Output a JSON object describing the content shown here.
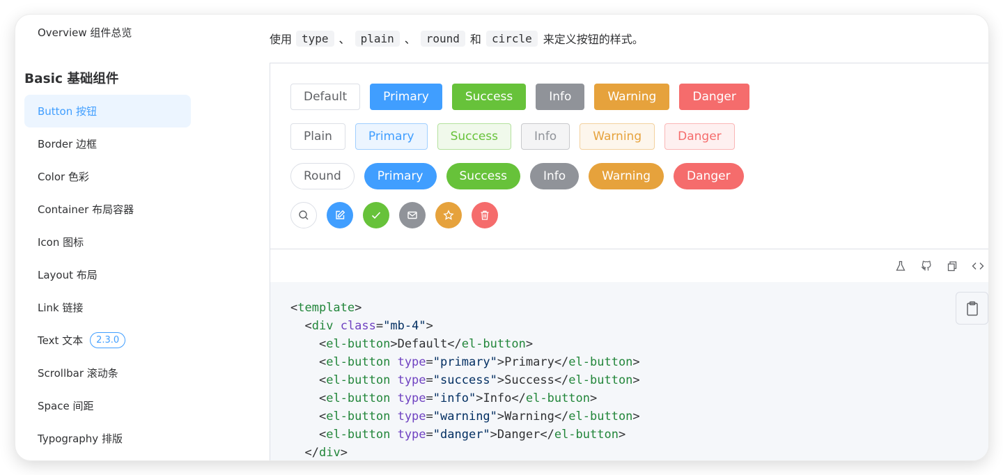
{
  "sidebar": {
    "overview": "Overview 组件总览",
    "heading": "Basic 基础组件",
    "items": [
      {
        "label": "Button 按钮"
      },
      {
        "label": "Border 边框"
      },
      {
        "label": "Color 色彩"
      },
      {
        "label": "Container 布局容器"
      },
      {
        "label": "Icon 图标"
      },
      {
        "label": "Layout 布局"
      },
      {
        "label": "Link 链接"
      },
      {
        "label": "Text 文本",
        "badge": "2.3.0"
      },
      {
        "label": "Scrollbar 滚动条"
      },
      {
        "label": "Space 间距"
      },
      {
        "label": "Typography 排版"
      }
    ]
  },
  "intro": {
    "prefix": "使用",
    "code1": "type",
    "sep1": "、",
    "code2": "plain",
    "sep2": "、",
    "code3": "round",
    "mid": "和",
    "code4": "circle",
    "suffix": "来定义按钮的样式。"
  },
  "rows": {
    "solid": [
      "Default",
      "Primary",
      "Success",
      "Info",
      "Warning",
      "Danger"
    ],
    "plain": [
      "Plain",
      "Primary",
      "Success",
      "Info",
      "Warning",
      "Danger"
    ],
    "round": [
      "Round",
      "Primary",
      "Success",
      "Info",
      "Warning",
      "Danger"
    ]
  },
  "circle_icons": [
    "search-icon",
    "edit-icon",
    "check-icon",
    "message-icon",
    "star-icon",
    "delete-icon"
  ],
  "toolbar_icons": [
    "playground-icon",
    "github-icon",
    "copy-icon",
    "view-source-icon"
  ],
  "code": {
    "l1": {
      "open": "<",
      "tag": "template",
      "close": ">"
    },
    "l2": {
      "indent": "  ",
      "open": "<",
      "tag": "div",
      "sp": " ",
      "attr": "class",
      "eq": "=",
      "val": "\"mb-4\"",
      "close": ">"
    },
    "l3": {
      "indent": "    ",
      "open": "<",
      "tag": "el-button",
      "close": ">",
      "text": "Default",
      "eopen": "</",
      "etag": "el-button",
      "eclose": ">"
    },
    "l4": {
      "indent": "    ",
      "open": "<",
      "tag": "el-button",
      "sp": " ",
      "attr": "type",
      "eq": "=",
      "val": "\"primary\"",
      "close": ">",
      "text": "Primary",
      "eopen": "</",
      "etag": "el-button",
      "eclose": ">"
    },
    "l5": {
      "indent": "    ",
      "open": "<",
      "tag": "el-button",
      "sp": " ",
      "attr": "type",
      "eq": "=",
      "val": "\"success\"",
      "close": ">",
      "text": "Success",
      "eopen": "</",
      "etag": "el-button",
      "eclose": ">"
    },
    "l6": {
      "indent": "    ",
      "open": "<",
      "tag": "el-button",
      "sp": " ",
      "attr": "type",
      "eq": "=",
      "val": "\"info\"",
      "close": ">",
      "text": "Info",
      "eopen": "</",
      "etag": "el-button",
      "eclose": ">"
    },
    "l7": {
      "indent": "    ",
      "open": "<",
      "tag": "el-button",
      "sp": " ",
      "attr": "type",
      "eq": "=",
      "val": "\"warning\"",
      "close": ">",
      "text": "Warning",
      "eopen": "</",
      "etag": "el-button",
      "eclose": ">"
    },
    "l8": {
      "indent": "    ",
      "open": "<",
      "tag": "el-button",
      "sp": " ",
      "attr": "type",
      "eq": "=",
      "val": "\"danger\"",
      "close": ">",
      "text": "Danger",
      "eopen": "</",
      "etag": "el-button",
      "eclose": ">"
    },
    "l9": {
      "indent": "  ",
      "open": "</",
      "tag": "div",
      "close": ">"
    }
  },
  "colors": {
    "primary": "#409eff",
    "success": "#67c23a",
    "info": "#909399",
    "warning": "#e6a23c",
    "danger": "#f56c6c"
  }
}
